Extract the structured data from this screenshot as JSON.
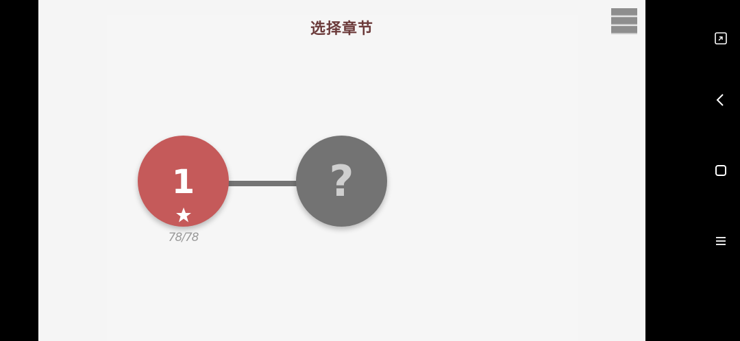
{
  "app": {
    "title": "选择章节",
    "menu_icon": "hamburger-menu-icon"
  },
  "chapters": [
    {
      "label": "1",
      "status": "unlocked",
      "progress_text": "78/78",
      "star_icon": "star-icon",
      "color": "#c55a5a"
    },
    {
      "label": "?",
      "status": "locked",
      "color": "#737373"
    }
  ],
  "colors": {
    "title": "#6b3a3a",
    "background": "#f5f5f5",
    "connector": "#747474"
  },
  "system_nav": {
    "buttons": [
      "fullscreen-icon",
      "back-icon",
      "home-icon",
      "menu-icon"
    ]
  }
}
